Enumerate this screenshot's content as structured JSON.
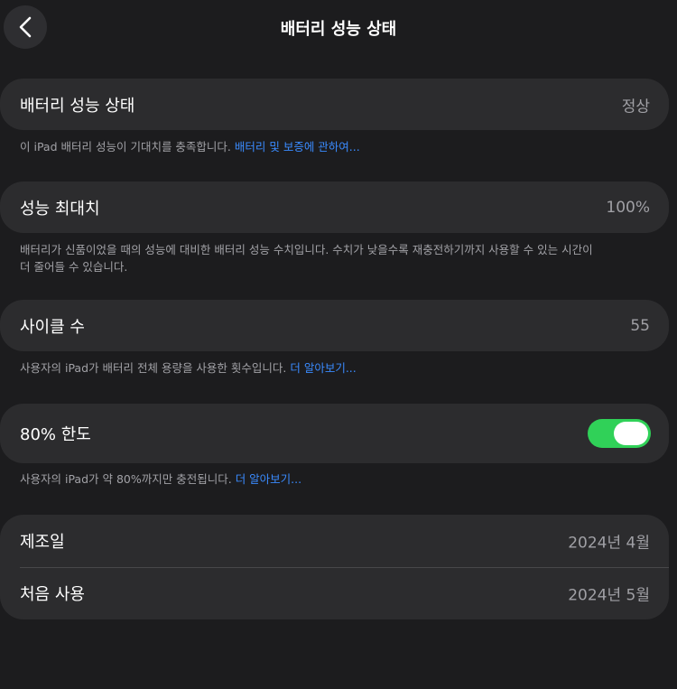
{
  "nav": {
    "title": "배터리 성능 상태",
    "back_icon": "chevron-left-icon"
  },
  "battery_health": {
    "label": "배터리 성능 상태",
    "value": "정상",
    "footnote": "이 iPad 배터리 성능이 기대치를 충족합니다.",
    "footnote_link": "배터리 및 보증에 관하여..."
  },
  "maximum_capacity": {
    "label": "성능 최대치",
    "value": "100%",
    "footnote_line1": "배터리가 신품이었을 때의 성능에 대비한 배터리 성능 수치입니다. 수치가 낮을수록 재충전하기까지 사용할 수 있는 시간이",
    "footnote_line2": "더 줄어들 수 있습니다."
  },
  "cycle_count": {
    "label": "사이클 수",
    "value": "55",
    "footnote": "사용자의 iPad가 배터리 전체 용량을 사용한 횟수입니다.",
    "footnote_link": "더 알아보기..."
  },
  "limit_80": {
    "label": "80% 한도",
    "toggle_on": true,
    "footnote": "사용자의 iPad가 약 80%까지만 충전됩니다.",
    "footnote_link": "더 알아보기..."
  },
  "dates": {
    "manufacture_label": "제조일",
    "manufacture_value": "2024년 4월",
    "first_use_label": "처음 사용",
    "first_use_value": "2024년 5월"
  },
  "colors": {
    "background": "#1c1c1e",
    "cell": "#2c2c2e",
    "link": "#3a8bff",
    "toggle_on": "#30d158",
    "secondary_text": "#a1a1a6"
  }
}
